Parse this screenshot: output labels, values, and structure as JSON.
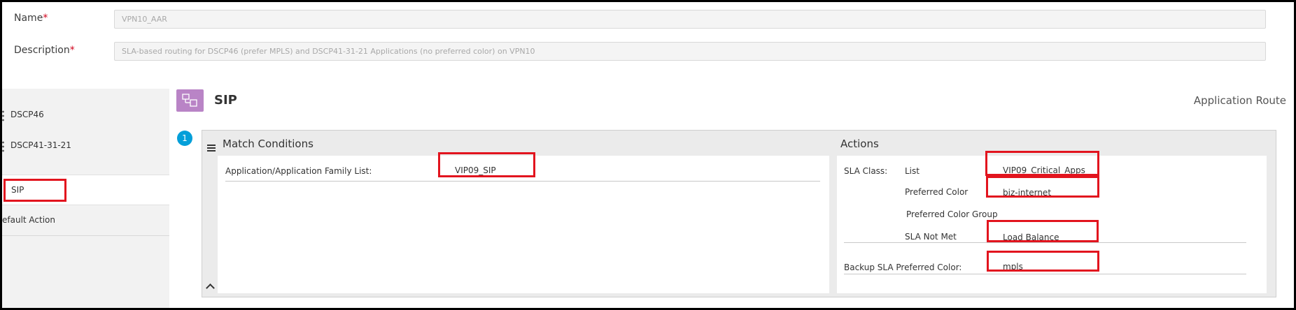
{
  "form": {
    "name_label": "Name",
    "name_required": "*",
    "name_value": "VPN10_AAR",
    "description_label": "Description",
    "description_required": "*",
    "description_value": "SLA-based routing for DSCP46 (prefer MPLS) and DSCP41-31-21 Applications (no preferred color) on VPN10"
  },
  "sidebar": {
    "items": [
      {
        "label": "DSCP46"
      },
      {
        "label": "DSCP41-31-21"
      },
      {
        "label": "SIP"
      },
      {
        "label": "efault Action"
      }
    ]
  },
  "sequence": {
    "title": "SIP",
    "type_label": "Application Route",
    "icon": "application-route-icon"
  },
  "rule": {
    "number": "1",
    "match": {
      "title": "Match Conditions",
      "condition_label": "Application/Application Family List:",
      "condition_value": "VIP09_SIP"
    },
    "actions": {
      "title": "Actions",
      "sla_class_label": "SLA Class:",
      "list_label": "List",
      "list_value": "VIP09_Critical_Apps",
      "preferred_color_label": "Preferred Color",
      "preferred_color_value": "biz-internet",
      "preferred_color_group_label": "Preferred Color Group",
      "sla_not_met_label": "SLA Not Met",
      "sla_not_met_value": "Load Balance",
      "backup_label": "Backup SLA Preferred Color:",
      "backup_value": "mpls"
    }
  },
  "colors": {
    "highlight": "#e2141e",
    "badge": "#049fd9",
    "sequence_icon": "#b984c6",
    "required": "#d0021b"
  }
}
